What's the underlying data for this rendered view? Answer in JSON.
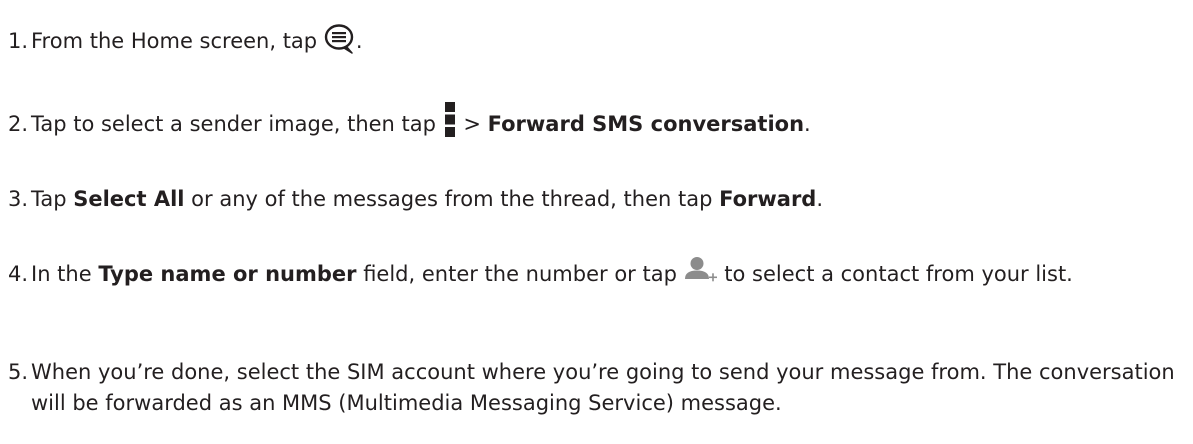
{
  "steps": [
    {
      "number": "1.",
      "text_before": "From the Home screen, tap ",
      "icon": "messaging-app-icon",
      "text_after": "."
    },
    {
      "number": "2.",
      "text_before": "Tap to select a sender image, then tap ",
      "icon": "overflow-menu-icon",
      "text_middle": " > ",
      "bold": "Forward SMS conversation",
      "text_after": "."
    },
    {
      "number": "3.",
      "text_before": "Tap ",
      "bold1": "Select All",
      "text_middle": " or any of the messages from the thread, then tap ",
      "bold2": "Forward",
      "text_after": "."
    },
    {
      "number": "4.",
      "text_before": "In the ",
      "bold": "Type name or number",
      "text_middle": " field, enter the number or tap ",
      "icon": "add-contact-icon",
      "text_after": " to select a contact from your list."
    },
    {
      "number": "5.",
      "text": "When you’re done, select the SIM account where you’re going to send your message from. The conversation will be forwarded as an MMS (Multimedia Messaging Service) message."
    }
  ]
}
